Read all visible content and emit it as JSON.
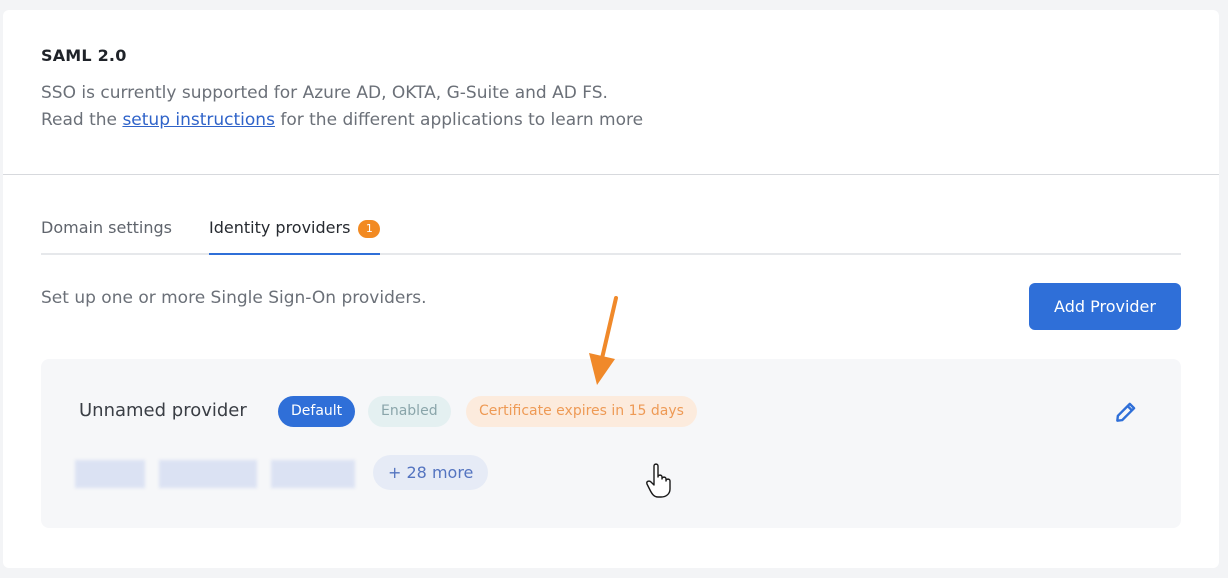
{
  "header": {
    "title": "SAML 2.0",
    "line1": "SSO is currently supported for Azure AD, OKTA, G-Suite and AD FS.",
    "line2_prefix": "Read the",
    "line2_link": "setup instructions",
    "line2_suffix": "for the different applications to learn more"
  },
  "tabs": [
    {
      "label": "Domain settings",
      "active": false
    },
    {
      "label": "Identity providers",
      "active": true,
      "badge": "1"
    }
  ],
  "subtitle": "Set up one or more Single Sign-On providers.",
  "add_button": "Add Provider",
  "provider": {
    "name": "Unnamed provider",
    "chips": {
      "default": "Default",
      "enabled": "Enabled",
      "certificate": "Certificate expires in 15 days"
    },
    "more_domains": "+ 28 more"
  },
  "icons": {
    "edit": "pencil-icon",
    "annotation_arrow": "arrow-down-icon",
    "cursor": "hand-pointer-icon"
  },
  "colors": {
    "primary": "#2f6fd8",
    "badge": "#f28a22",
    "cert_text": "#ee9a55",
    "cert_bg": "#fcebdd",
    "enabled_bg": "#e4f0f1"
  }
}
